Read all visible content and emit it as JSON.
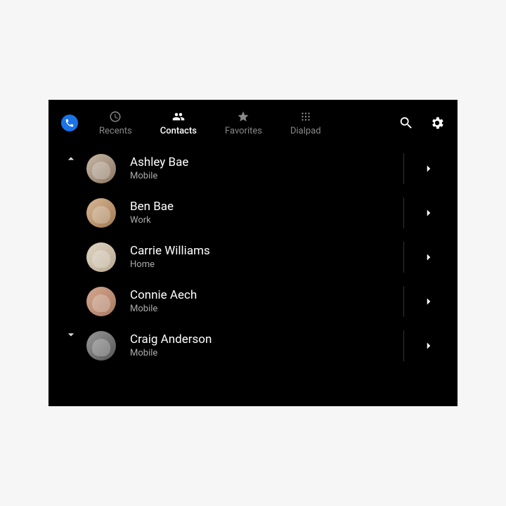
{
  "tabs": [
    {
      "label": "Recents",
      "active": false
    },
    {
      "label": "Contacts",
      "active": true
    },
    {
      "label": "Favorites",
      "active": false
    },
    {
      "label": "Dialpad",
      "active": false
    }
  ],
  "contacts": [
    {
      "name": "Ashley Bae",
      "sub": "Mobile"
    },
    {
      "name": "Ben Bae",
      "sub": "Work"
    },
    {
      "name": "Carrie Williams",
      "sub": "Home"
    },
    {
      "name": "Connie Aech",
      "sub": "Mobile"
    },
    {
      "name": "Craig Anderson",
      "sub": "Mobile"
    }
  ]
}
